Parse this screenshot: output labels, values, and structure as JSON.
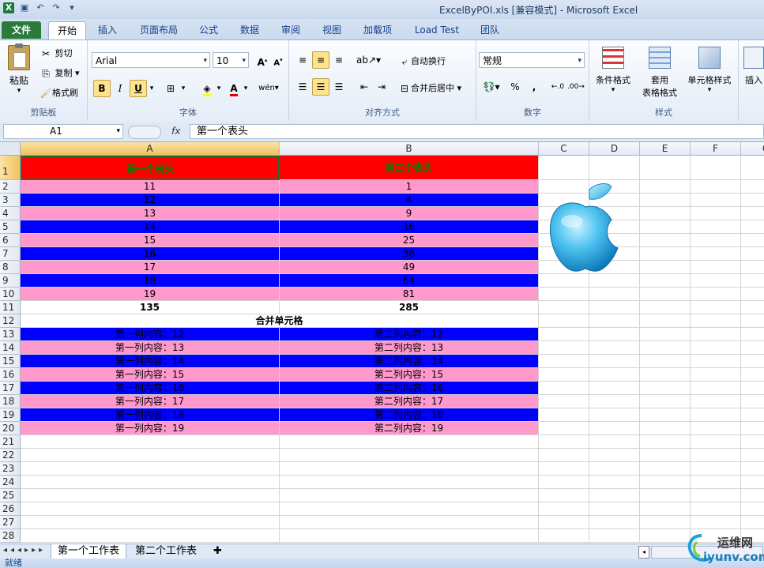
{
  "window": {
    "title": "ExcelByPOI.xls  [兼容模式] - Microsoft Excel"
  },
  "tabs": [
    "文件",
    "开始",
    "插入",
    "页面布局",
    "公式",
    "数据",
    "审阅",
    "视图",
    "加载项",
    "Load Test",
    "团队"
  ],
  "ribbon": {
    "clipboard": {
      "paste": "粘贴",
      "cut": "剪切",
      "copy": "复制",
      "format_painter": "格式刷",
      "label": "剪贴板"
    },
    "font": {
      "name": "Arial",
      "size": "10",
      "bold": "B",
      "italic": "I",
      "underline": "U",
      "label": "字体"
    },
    "alignment": {
      "wrap_text": "自动换行",
      "merge_center": "合并后居中",
      "label": "对齐方式"
    },
    "number": {
      "format": "常规",
      "percent": "%",
      "comma": ",",
      "label": "数字"
    },
    "styles": {
      "conditional": "条件格式",
      "table1": "套用",
      "table2": "表格格式",
      "cell_styles": "单元格样式",
      "label": "样式"
    },
    "cells": {
      "insert": "插入"
    }
  },
  "formula_bar": {
    "name_box": "A1",
    "fx": "fx",
    "content": "第一个表头"
  },
  "grid": {
    "columns": [
      "A",
      "B",
      "C",
      "D",
      "E",
      "F",
      "G"
    ],
    "rows": [
      "1",
      "2",
      "3",
      "4",
      "5",
      "6",
      "7",
      "8",
      "9",
      "10",
      "11",
      "12",
      "13",
      "14",
      "15",
      "16",
      "17",
      "18",
      "19",
      "20",
      "21",
      "22",
      "23",
      "24",
      "25",
      "26",
      "27",
      "28"
    ],
    "header": {
      "a": "第一个表头",
      "b": "第二个表头"
    },
    "data": [
      {
        "a": "11",
        "b": "1"
      },
      {
        "a": "12",
        "b": "4"
      },
      {
        "a": "13",
        "b": "9"
      },
      {
        "a": "14",
        "b": "16"
      },
      {
        "a": "15",
        "b": "25"
      },
      {
        "a": "16",
        "b": "36"
      },
      {
        "a": "17",
        "b": "49"
      },
      {
        "a": "18",
        "b": "64"
      },
      {
        "a": "19",
        "b": "81"
      }
    ],
    "totals": {
      "a": "135",
      "b": "285"
    },
    "merged": "合并单元格",
    "content_rows": [
      {
        "a": "第一列内容：12",
        "b": "第二列内容：12"
      },
      {
        "a": "第一列内容：13",
        "b": "第二列内容：13"
      },
      {
        "a": "第一列内容：14",
        "b": "第二列内容：14"
      },
      {
        "a": "第一列内容：15",
        "b": "第二列内容：15"
      },
      {
        "a": "第一列内容：16",
        "b": "第二列内容：16"
      },
      {
        "a": "第一列内容：17",
        "b": "第二列内容：17"
      },
      {
        "a": "第一列内容：18",
        "b": "第二列内容：18"
      },
      {
        "a": "第一列内容：19",
        "b": "第二列内容：19"
      }
    ]
  },
  "sheets": [
    "第一个工作表",
    "第二个工作表"
  ],
  "status": "就绪",
  "watermark": {
    "top": "运维网",
    "bottom": "iyunv.com"
  },
  "colors": {
    "header_fill": "#ff0000",
    "header_text": "#008000",
    "pink": "#ff99cc",
    "blue": "#0000ff"
  }
}
